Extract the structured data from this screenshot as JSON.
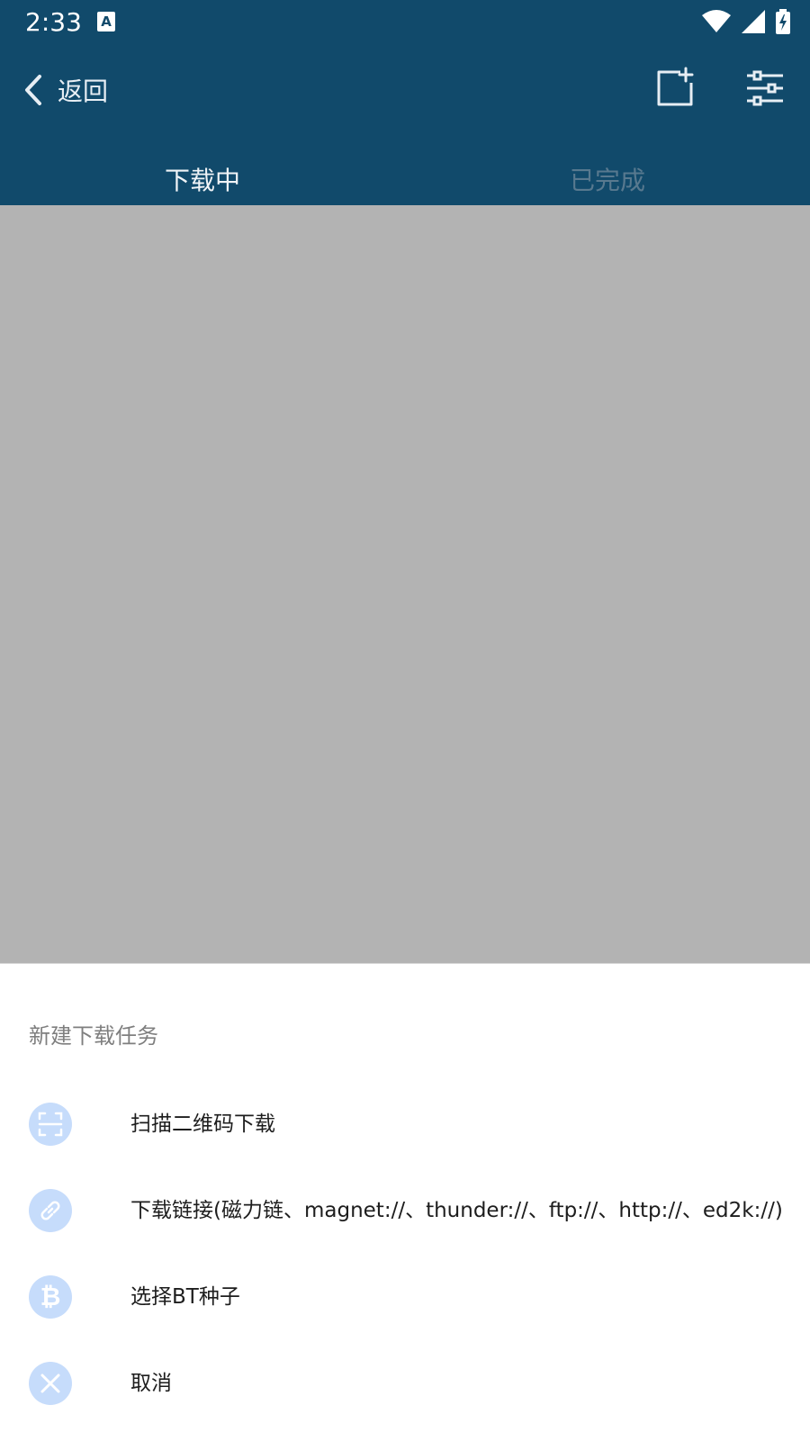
{
  "status_bar": {
    "time": "2:33",
    "notification_icon": "A"
  },
  "app_bar": {
    "back_label": "返回",
    "icons": [
      "chevron-left-icon",
      "add-task-icon",
      "filter-sliders-icon"
    ]
  },
  "tabs": [
    {
      "label": "下载中",
      "active": true
    },
    {
      "label": "已完成",
      "active": false
    }
  ],
  "sheet": {
    "title": "新建下载任务",
    "options": [
      {
        "label": "扫描二维码下载",
        "icon": "qr-scan-icon"
      },
      {
        "label": "下载链接(磁力链、magnet://、thunder://、ftp://、http://、ed2k://)",
        "icon": "link-icon"
      },
      {
        "label": "选择BT种子",
        "icon": "bitcoin-icon"
      },
      {
        "label": "取消",
        "icon": "close-icon"
      }
    ]
  },
  "colors": {
    "header_bg": "#114a6b",
    "overlay": "#b3b3b3",
    "icon_circle": "#c6dcfb"
  }
}
